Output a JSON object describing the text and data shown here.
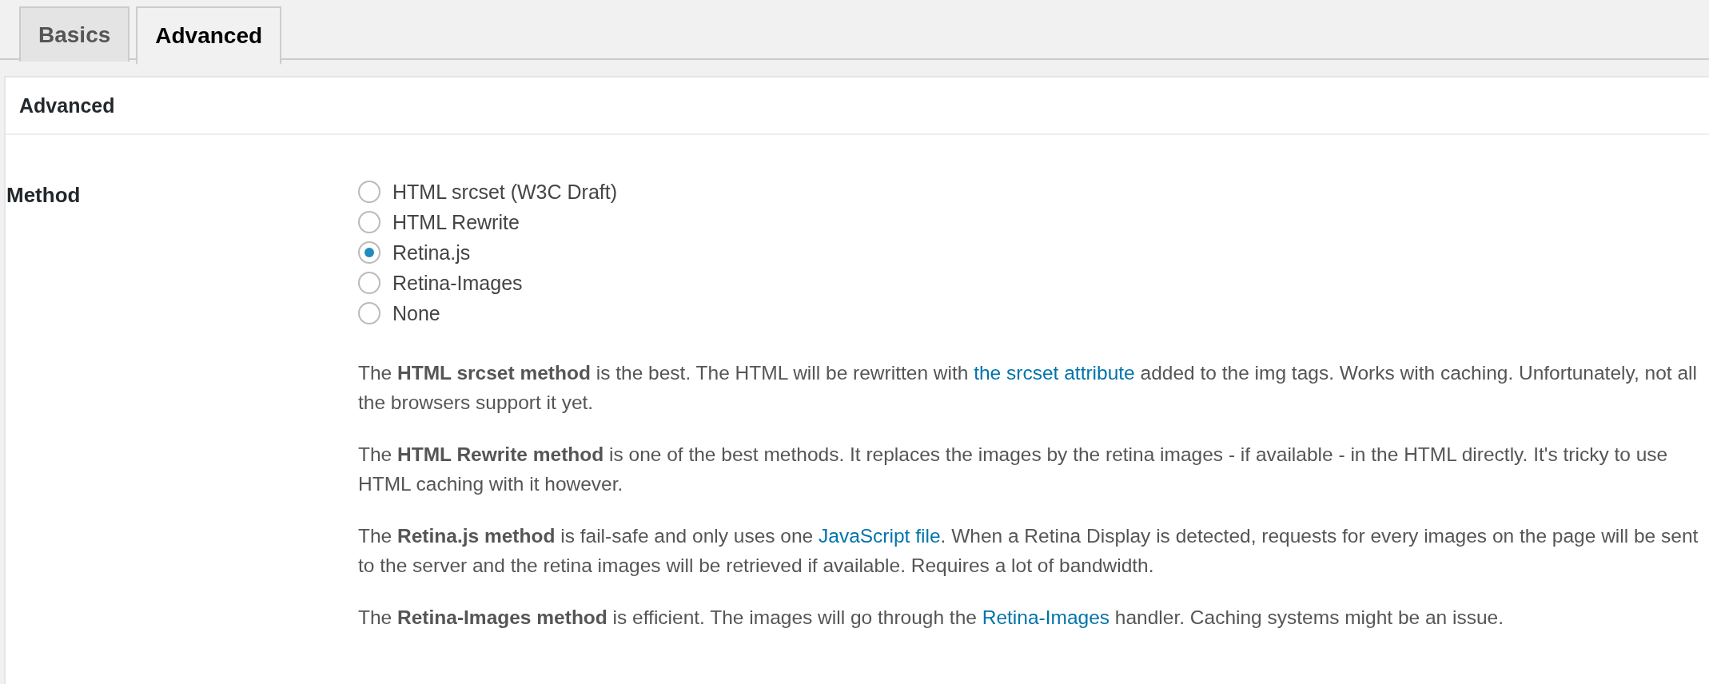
{
  "tabs": [
    {
      "label": "Basics",
      "selected": false
    },
    {
      "label": "Advanced",
      "selected": true
    }
  ],
  "panel": {
    "title": "Advanced"
  },
  "method": {
    "label": "Method",
    "options": [
      {
        "label": "HTML srcset (W3C Draft)",
        "selected": false
      },
      {
        "label": "HTML Rewrite",
        "selected": false
      },
      {
        "label": "Retina.js",
        "selected": true
      },
      {
        "label": "Retina-Images",
        "selected": false
      },
      {
        "label": "None",
        "selected": false
      }
    ],
    "descriptions": [
      [
        {
          "kind": "text",
          "text": "The **HTML srcset method** is the best. The HTML will be rewritten with "
        },
        {
          "kind": "link",
          "text": "the srcset attribute"
        },
        {
          "kind": "text",
          "text": " added to the img tags. Works with caching. Unfortunately, not all the browsers support it yet."
        }
      ],
      [
        {
          "kind": "text",
          "text": "The **HTML Rewrite method** is one of the best methods. It replaces the images by the retina images - if available - in the HTML directly. It's tricky to use HTML caching with it however."
        }
      ],
      [
        {
          "kind": "text",
          "text": "The **Retina.js method** is fail-safe and only uses one "
        },
        {
          "kind": "link",
          "text": "JavaScript file"
        },
        {
          "kind": "text",
          "text": ". When a Retina Display is detected, requests for every images on the page will be sent to the server and the retina images will be retrieved if available. Requires a lot of bandwidth."
        }
      ],
      [
        {
          "kind": "text",
          "text": "The **Retina-Images method** is efficient. The images will go through the "
        },
        {
          "kind": "link",
          "text": "Retina-Images"
        },
        {
          "kind": "text",
          "text": " handler. Caching systems might be an issue."
        }
      ]
    ]
  }
}
